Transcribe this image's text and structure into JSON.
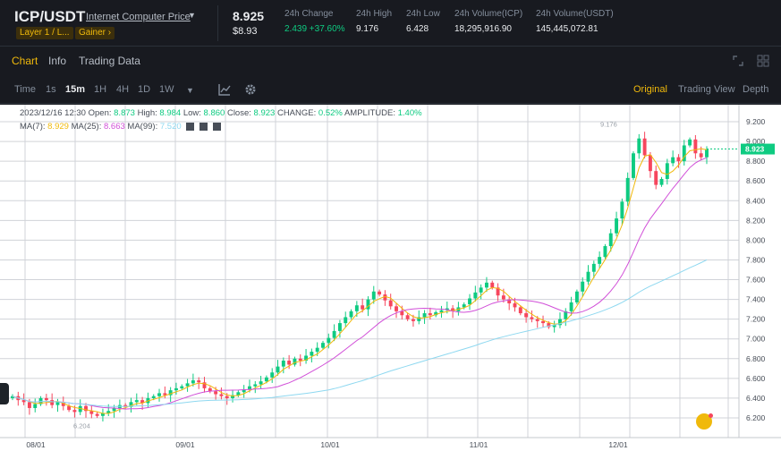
{
  "header": {
    "pair": "ICP/USDT",
    "pair_link": "Internet Computer Price",
    "tags": [
      "Layer 1 / L...",
      "Gainer ›"
    ],
    "price": "8.925",
    "price_usd": "$8.93",
    "stats": [
      {
        "label": "24h Change",
        "value": "2.439 +37.60%"
      },
      {
        "label": "24h High",
        "value": "9.176"
      },
      {
        "label": "24h Low",
        "value": "6.428"
      },
      {
        "label": "24h Volume(ICP)",
        "value": "18,295,916.90"
      },
      {
        "label": "24h Volume(USDT)",
        "value": "145,445,072.81"
      }
    ]
  },
  "tabs": [
    "Chart",
    "Info",
    "Trading Data"
  ],
  "toolbar": {
    "intervals": [
      "Time",
      "1s",
      "15m",
      "1H",
      "4H",
      "1D",
      "1W"
    ],
    "active_interval": "15m",
    "views": [
      "Original",
      "Trading View",
      "Depth"
    ],
    "active_view": "Original"
  },
  "legend": {
    "date": "2023/12/16 12:30",
    "open_label": "Open:",
    "open": "8.873",
    "high_label": "High:",
    "high": "8.984",
    "low_label": "Low:",
    "low": "8.860",
    "close_label": "Close:",
    "close": "8.923",
    "change_label": "CHANGE:",
    "change": "0.52%",
    "amp_label": "AMPLITUDE:",
    "amp": "1.40%",
    "ma7_label": "MA(7):",
    "ma7": "8.929",
    "ma25_label": "MA(25):",
    "ma25": "8.663",
    "ma99_label": "MA(99):",
    "ma99": "7.520"
  },
  "colors": {
    "up": "#0ecb81",
    "down": "#f6465d",
    "accent": "#f0b90b",
    "ma7": "#f0b90b",
    "ma25": "#d14fd8",
    "ma99": "#8ed8f0"
  },
  "chart_data": {
    "type": "candlestick",
    "ylim": [
      6.1,
      9.3
    ],
    "y_ticks": [
      "9.200",
      "9.000",
      "8.800",
      "8.600",
      "8.400",
      "8.200",
      "8.000",
      "7.800",
      "7.600",
      "7.400",
      "7.200",
      "7.000",
      "6.800",
      "6.600",
      "6.400",
      "6.200"
    ],
    "x_ticks": [
      "08/01",
      "09/01",
      "10/01",
      "11/01",
      "12/01"
    ],
    "last_price_label": "8.923",
    "max_label": "9.176",
    "min_label": "6.204",
    "close_series": [
      6.42,
      6.38,
      6.36,
      6.3,
      6.34,
      6.4,
      6.38,
      6.33,
      6.36,
      6.32,
      6.28,
      6.26,
      6.32,
      6.27,
      6.24,
      6.22,
      6.25,
      6.27,
      6.3,
      6.33,
      6.31,
      6.36,
      6.38,
      6.35,
      6.4,
      6.42,
      6.45,
      6.43,
      6.48,
      6.5,
      6.52,
      6.55,
      6.58,
      6.56,
      6.5,
      6.47,
      6.44,
      6.42,
      6.4,
      6.43,
      6.46,
      6.49,
      6.52,
      6.54,
      6.57,
      6.61,
      6.66,
      6.72,
      6.78,
      6.74,
      6.8,
      6.78,
      6.83,
      6.87,
      6.91,
      6.96,
      7.01,
      7.08,
      7.16,
      7.22,
      7.28,
      7.34,
      7.3,
      7.4,
      7.48,
      7.45,
      7.39,
      7.33,
      7.28,
      7.24,
      7.2,
      7.18,
      7.22,
      7.26,
      7.24,
      7.27,
      7.29,
      7.31,
      7.28,
      7.32,
      7.35,
      7.41,
      7.47,
      7.52,
      7.57,
      7.52,
      7.44,
      7.4,
      7.36,
      7.32,
      7.26,
      7.22,
      7.2,
      7.18,
      7.16,
      7.12,
      7.14,
      7.2,
      7.28,
      7.37,
      7.48,
      7.58,
      7.68,
      7.76,
      7.83,
      7.94,
      8.07,
      8.22,
      8.39,
      8.63,
      8.88,
      9.03,
      8.86,
      8.7,
      8.56,
      8.62,
      8.78,
      8.84,
      8.8,
      8.96,
      9.02,
      8.88,
      8.84,
      8.92
    ]
  }
}
